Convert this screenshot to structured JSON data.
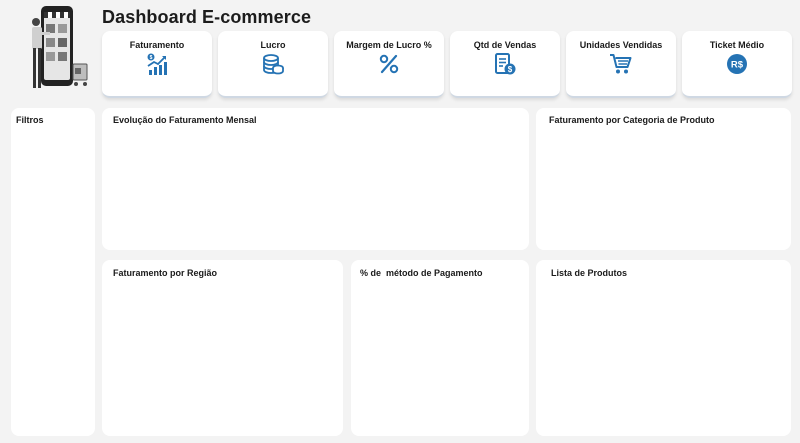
{
  "header": {
    "title": "Dashboard E-commerce"
  },
  "kpis": [
    {
      "label": "Faturamento",
      "icon": "revenue-chart-icon"
    },
    {
      "label": "Lucro",
      "icon": "coins-icon"
    },
    {
      "label": "Margem de Lucro %",
      "icon": "percent-icon"
    },
    {
      "label": "Qtd de Vendas",
      "icon": "invoice-icon"
    },
    {
      "label": "Unidades Vendidas",
      "icon": "shopping-cart-icon"
    },
    {
      "label": "Ticket Médio",
      "icon": "real-currency-icon",
      "icon_text": "R$"
    }
  ],
  "panels": {
    "filtros": "Filtros",
    "evolucao": "Evolução do Faturamento Mensal",
    "categoria": "Faturamento por Categoria de Produto",
    "regiao": "Faturamento por Região",
    "pagamento": "% de  método de Pagamento",
    "produtos": "Lista de Produtos"
  },
  "colors": {
    "accent": "#2573b4",
    "background": "#f3f3f3",
    "panel": "#ffffff"
  }
}
